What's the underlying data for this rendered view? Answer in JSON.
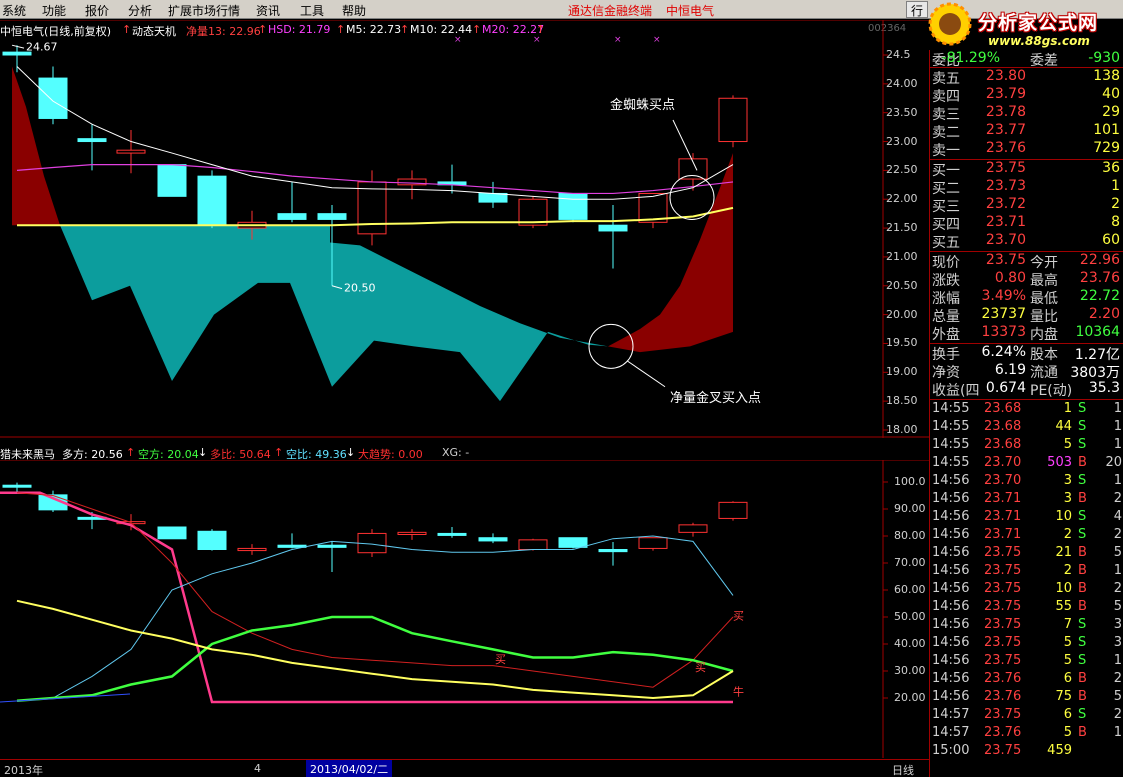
{
  "menu": {
    "items": [
      "系统",
      "功能",
      "报价",
      "分析",
      "扩展市场行情",
      "资讯",
      "工具",
      "帮助"
    ],
    "brand_left": "通达信金融终端",
    "brand_right": "中恒电气",
    "tab_label": "行"
  },
  "watermark": {
    "title": "分析家公式网",
    "url": "www.88gs.com"
  },
  "chart_header": {
    "stock": "中恒电气(日线,前复权)",
    "indicator": "动态天机",
    "items": [
      {
        "label": "净量13: 22.96",
        "color": "#ff4040",
        "arrow": "↑"
      },
      {
        "label": "HSD: 21.79",
        "color": "#ff40ff",
        "arrow": "↑"
      },
      {
        "label": "M5: 22.73",
        "color": "#ffffff",
        "arrow": "↑"
      },
      {
        "label": "M10: 22.44",
        "color": "#ffffff",
        "arrow": "↑"
      },
      {
        "label": "M20: 22.27",
        "color": "#ff40ff",
        "arrow": "↑"
      }
    ],
    "code": "002364",
    "code_suffix": "中恒电气"
  },
  "main_chart": {
    "y_ticks": [
      "24.5",
      "24.00",
      "23.50",
      "23.00",
      "22.50",
      "22.00",
      "21.50",
      "21.00",
      "20.50",
      "20.00",
      "19.50",
      "19.00",
      "18.50",
      "18.00"
    ],
    "max_label": "24.67",
    "min_label": "20.50",
    "annotation_spider": "金蜘蛛买点",
    "annotation_cross": "净量金叉买入点"
  },
  "indicator_header": {
    "name": "猎未来黑马",
    "items": [
      {
        "label": "多方: 20.56",
        "color": "#ffffff",
        "arrow": "↑",
        "arrowColor": "#ff3030"
      },
      {
        "label": "空方: 20.04",
        "color": "#40ff40",
        "arrow": "↓",
        "arrowColor": "#ffffff"
      },
      {
        "label": "多比: 50.64",
        "color": "#ff3030",
        "arrow": "↑",
        "arrowColor": "#ff3030"
      },
      {
        "label": "空比: 49.36",
        "color": "#60e0ff",
        "arrow": "↓",
        "arrowColor": "#ffffff"
      },
      {
        "label": "大趋势: 0.00",
        "color": "#ff3030",
        "arrow": "",
        "arrowColor": "#ffffff"
      },
      {
        "label": "XG: -",
        "color": "#d0d0d0",
        "arrow": "",
        "arrowColor": "#ffffff"
      }
    ],
    "y_ticks": [
      "100.0",
      "90.00",
      "80.00",
      "70.00",
      "60.00",
      "50.00",
      "40.00",
      "30.00",
      "20.00"
    ],
    "marks": [
      "买",
      "买",
      "买",
      "牛"
    ]
  },
  "bottom": {
    "year": "2013年",
    "month": "4",
    "date": "2013/04/02/二",
    "period": "日线"
  },
  "quote": {
    "top_row": {
      "label1": "委比",
      "val1": "-81.29%",
      "label2": "委差",
      "val2": "-930"
    },
    "sells": [
      {
        "label": "卖五",
        "price": "23.80",
        "vol": "138"
      },
      {
        "label": "卖四",
        "price": "23.79",
        "vol": "40"
      },
      {
        "label": "卖三",
        "price": "23.78",
        "vol": "29"
      },
      {
        "label": "卖二",
        "price": "23.77",
        "vol": "101"
      },
      {
        "label": "卖一",
        "price": "23.76",
        "vol": "729"
      }
    ],
    "buys": [
      {
        "label": "买一",
        "price": "23.75",
        "vol": "36"
      },
      {
        "label": "买二",
        "price": "23.73",
        "vol": "1"
      },
      {
        "label": "买三",
        "price": "23.72",
        "vol": "2"
      },
      {
        "label": "买四",
        "price": "23.71",
        "vol": "8"
      },
      {
        "label": "买五",
        "price": "23.70",
        "vol": "60"
      }
    ],
    "stats": [
      {
        "l1": "现价",
        "v1": "23.75",
        "c1": "#ff4040",
        "l2": "今开",
        "v2": "22.96",
        "c2": "#ff4040"
      },
      {
        "l1": "涨跌",
        "v1": "0.80",
        "c1": "#ff4040",
        "l2": "最高",
        "v2": "23.76",
        "c2": "#ff4040"
      },
      {
        "l1": "涨幅",
        "v1": "3.49%",
        "c1": "#ff4040",
        "l2": "最低",
        "v2": "22.72",
        "c2": "#40ff40"
      },
      {
        "l1": "总量",
        "v1": "23737",
        "c1": "#ffff40",
        "l2": "量比",
        "v2": "2.20",
        "c2": "#ff4040"
      },
      {
        "l1": "外盘",
        "v1": "13373",
        "c1": "#ff4040",
        "l2": "内盘",
        "v2": "10364",
        "c2": "#40ff40"
      }
    ],
    "fund": [
      {
        "l1": "换手",
        "v1": "6.24%",
        "l2": "股本",
        "v2": "1.27亿"
      },
      {
        "l1": "净资",
        "v1": "6.19",
        "l2": "流通",
        "v2": "3803万"
      },
      {
        "l1": "收益(四",
        "v1": "0.674",
        "l2": "PE(动)",
        "v2": "35.3"
      }
    ]
  },
  "ticks": [
    {
      "time": "14:55",
      "price": "23.68",
      "vol": "1",
      "bs": "S",
      "n": "1"
    },
    {
      "time": "14:55",
      "price": "23.68",
      "vol": "44",
      "bs": "S",
      "n": "1"
    },
    {
      "time": "14:55",
      "price": "23.68",
      "vol": "5",
      "bs": "S",
      "n": "1"
    },
    {
      "time": "14:55",
      "price": "23.70",
      "vol": "503",
      "bs": "B",
      "n": "20"
    },
    {
      "time": "14:56",
      "price": "23.70",
      "vol": "3",
      "bs": "S",
      "n": "1"
    },
    {
      "time": "14:56",
      "price": "23.71",
      "vol": "3",
      "bs": "B",
      "n": "2"
    },
    {
      "time": "14:56",
      "price": "23.71",
      "vol": "10",
      "bs": "S",
      "n": "4"
    },
    {
      "time": "14:56",
      "price": "23.71",
      "vol": "2",
      "bs": "S",
      "n": "2"
    },
    {
      "time": "14:56",
      "price": "23.75",
      "vol": "21",
      "bs": "B",
      "n": "5"
    },
    {
      "time": "14:56",
      "price": "23.75",
      "vol": "2",
      "bs": "B",
      "n": "1"
    },
    {
      "time": "14:56",
      "price": "23.75",
      "vol": "10",
      "bs": "B",
      "n": "2"
    },
    {
      "time": "14:56",
      "price": "23.75",
      "vol": "55",
      "bs": "B",
      "n": "5"
    },
    {
      "time": "14:56",
      "price": "23.75",
      "vol": "7",
      "bs": "S",
      "n": "3"
    },
    {
      "time": "14:56",
      "price": "23.75",
      "vol": "5",
      "bs": "S",
      "n": "3"
    },
    {
      "time": "14:56",
      "price": "23.75",
      "vol": "5",
      "bs": "S",
      "n": "1"
    },
    {
      "time": "14:56",
      "price": "23.76",
      "vol": "6",
      "bs": "B",
      "n": "2"
    },
    {
      "time": "14:56",
      "price": "23.76",
      "vol": "75",
      "bs": "B",
      "n": "5"
    },
    {
      "time": "14:57",
      "price": "23.75",
      "vol": "6",
      "bs": "S",
      "n": "2"
    },
    {
      "time": "14:57",
      "price": "23.76",
      "vol": "5",
      "bs": "B",
      "n": "1"
    },
    {
      "time": "15:00",
      "price": "23.75",
      "vol": "459",
      "bs": "",
      "n": ""
    }
  ],
  "chart_data": {
    "type": "candlestick",
    "price_range": [
      18.0,
      24.7
    ],
    "candles": [
      {
        "o": 24.55,
        "h": 24.67,
        "l": 24.2,
        "c": 24.5
      },
      {
        "o": 24.1,
        "h": 24.3,
        "l": 23.3,
        "c": 23.4
      },
      {
        "o": 23.05,
        "h": 23.3,
        "l": 22.5,
        "c": 23.0
      },
      {
        "o": 22.8,
        "h": 23.2,
        "l": 22.45,
        "c": 22.85
      },
      {
        "o": 22.6,
        "h": 22.6,
        "l": 22.1,
        "c": 22.05
      },
      {
        "o": 22.4,
        "h": 22.5,
        "l": 21.5,
        "c": 21.55
      },
      {
        "o": 21.5,
        "h": 21.8,
        "l": 21.3,
        "c": 21.6
      },
      {
        "o": 21.75,
        "h": 22.3,
        "l": 21.6,
        "c": 21.65
      },
      {
        "o": 21.75,
        "h": 21.9,
        "l": 20.5,
        "c": 21.65
      },
      {
        "o": 21.4,
        "h": 22.5,
        "l": 21.2,
        "c": 22.3
      },
      {
        "o": 22.25,
        "h": 22.5,
        "l": 22.0,
        "c": 22.35
      },
      {
        "o": 22.3,
        "h": 22.6,
        "l": 22.1,
        "c": 22.25
      },
      {
        "o": 22.1,
        "h": 22.3,
        "l": 21.85,
        "c": 21.95
      },
      {
        "o": 21.55,
        "h": 22.05,
        "l": 21.5,
        "c": 22.0
      },
      {
        "o": 22.1,
        "h": 22.1,
        "l": 21.6,
        "c": 21.65
      },
      {
        "o": 21.55,
        "h": 21.9,
        "l": 20.8,
        "c": 21.45
      },
      {
        "o": 21.6,
        "h": 22.1,
        "l": 21.5,
        "c": 22.1
      },
      {
        "o": 22.35,
        "h": 22.8,
        "l": 22.15,
        "c": 22.7
      },
      {
        "o": 23.0,
        "h": 23.8,
        "l": 22.9,
        "c": 23.75
      }
    ],
    "net_flow_area": [
      21.55,
      21.55,
      20.25,
      20.5,
      18.85,
      20.0,
      19.7,
      20.55,
      18.75,
      19.6,
      18.45,
      19.35,
      19.45,
      18.45,
      18.7,
      19.35,
      19.45,
      19.4,
      19.7,
      20.1,
      21.0,
      22.8,
      19.6
    ],
    "ma_white": [
      24.3,
      23.7,
      23.3,
      23.0,
      22.8,
      22.6,
      22.4,
      22.3,
      22.2,
      22.18,
      22.17,
      22.15,
      22.1,
      22.05,
      22.0,
      22.0,
      22.05,
      22.2,
      22.6
    ],
    "ma_magenta": [
      22.5,
      22.55,
      22.6,
      22.6,
      22.6,
      22.55,
      22.48,
      22.4,
      22.35,
      22.3,
      22.28,
      22.25,
      22.2,
      22.15,
      22.1,
      22.1,
      22.15,
      22.22,
      22.3
    ],
    "ma_yellow": [
      21.55,
      21.55,
      21.55,
      21.55,
      21.55,
      21.55,
      21.55,
      21.55,
      21.55,
      21.57,
      21.58,
      21.6,
      21.6,
      21.6,
      21.62,
      21.62,
      21.65,
      21.7,
      21.85
    ],
    "indicator": {
      "pink": [
        96,
        96,
        88,
        84,
        75,
        18,
        18,
        18,
        18,
        18,
        18,
        18,
        18,
        18,
        18,
        18,
        18,
        18,
        18
      ],
      "red": [
        96,
        95,
        90,
        85,
        70,
        52,
        44,
        38,
        35,
        34,
        33,
        32,
        32,
        30,
        28,
        26,
        24,
        34,
        50
      ],
      "cyan": [
        19,
        20,
        28,
        38,
        60,
        66,
        70,
        75,
        78,
        77,
        75,
        74,
        74,
        75,
        75,
        79,
        80,
        78,
        58
      ],
      "green": [
        19,
        20,
        21,
        25,
        28,
        40,
        45,
        47,
        50,
        50,
        44,
        41,
        38,
        35,
        35,
        37,
        36,
        34,
        30
      ],
      "yellow": [
        56,
        53,
        49,
        45,
        42,
        38,
        36,
        33,
        31,
        29,
        27,
        26,
        25,
        23,
        22,
        21,
        20,
        21,
        30
      ]
    }
  }
}
